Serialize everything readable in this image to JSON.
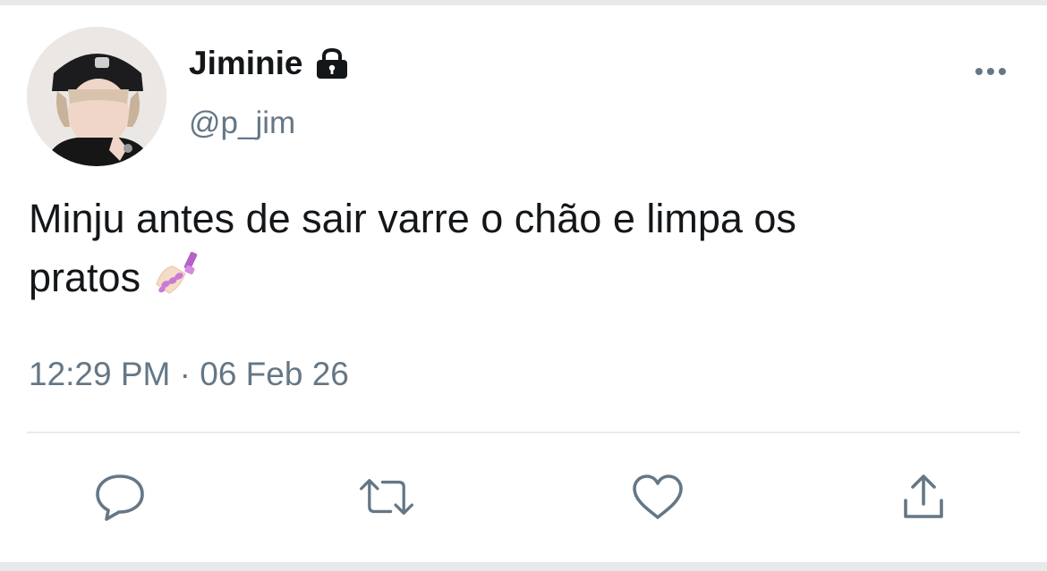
{
  "tweet": {
    "author": {
      "display_name": "Jiminie",
      "handle": "@p_jim",
      "protected_icon": "lock-icon",
      "avatar": "profile-photo"
    },
    "text_line_1": "Minju antes de sair varre o chão e limpa os",
    "text_line_2": "pratos",
    "emoji": "nail-polish-emoji",
    "timestamp": "12:29 PM · 06 Feb 26",
    "menu_icon": "more-horizontal-icon"
  },
  "actions": [
    {
      "icon": "reply-icon"
    },
    {
      "icon": "retweet-icon"
    },
    {
      "icon": "like-icon"
    },
    {
      "icon": "share-icon"
    }
  ],
  "colors": {
    "text_primary": "#14171a",
    "text_secondary": "#657786",
    "icon": "#657786",
    "divider": "#e6ecf0",
    "background": "#ffffff"
  }
}
